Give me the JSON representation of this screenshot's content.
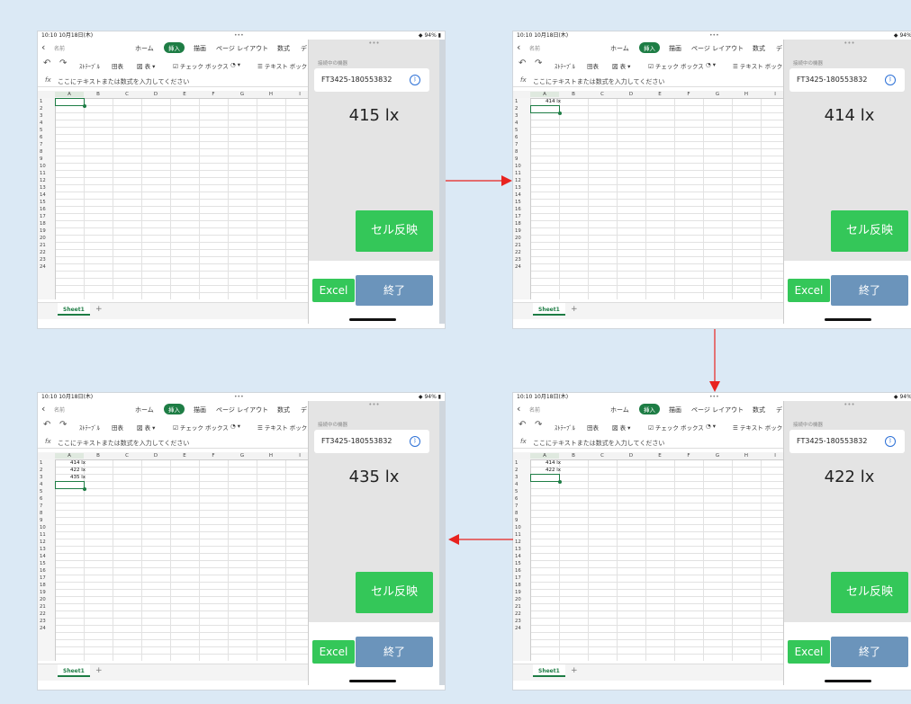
{
  "status": {
    "time": "10:10 10月18日(木)",
    "dots": "•••",
    "battery": "◆ 94% ▮"
  },
  "excel": {
    "file_name": "名前",
    "tabs": [
      "ホーム",
      "挿入",
      "描画",
      "ページ レイアウト",
      "数式",
      "デ"
    ],
    "active_tab": "挿入",
    "toolbar": {
      "undo": "↶",
      "redo": "↷",
      "table_layout": "ｽﾄﾃｰﾌﾞﾙ",
      "table": "田表",
      "chart": "図 表 ▾",
      "checkbox": "☑ チェック ボックス",
      "shapes": "◔ ▾",
      "textbox": "☰ テキスト ボックス"
    },
    "formula_fx": "fx",
    "formula_placeholder": "ここにテキストまたは数式を入力してください",
    "col_headers": [
      "A",
      "B",
      "C",
      "D",
      "E",
      "F",
      "G",
      "H",
      "I"
    ],
    "row_headers": [
      "1",
      "2",
      "3",
      "4",
      "5",
      "6",
      "7",
      "8",
      "9",
      "10",
      "11",
      "12",
      "13",
      "14",
      "15",
      "16",
      "17",
      "18",
      "19",
      "20",
      "21",
      "22",
      "23",
      "24"
    ],
    "sheet_tab": "Sheet1",
    "add_sheet": "+"
  },
  "app": {
    "handle": "•••",
    "label": "接続中の機器",
    "device_id": "FT3425-180553832",
    "bt_icon": "bluetooth-icon",
    "bt_glyph": "ᛒ",
    "reflect_label": "セル反映",
    "excel_label": "Excel",
    "end_label": "終了"
  },
  "panels": [
    {
      "lux": "415 lx",
      "cells": [],
      "selected_row": 1
    },
    {
      "lux": "414 lx",
      "cells": [
        "414 lx"
      ],
      "selected_row": 2
    },
    {
      "lux": "435 lx",
      "cells": [
        "414 lx",
        "422 lx",
        "435 lx"
      ],
      "selected_row": 4
    },
    {
      "lux": "422 lx",
      "cells": [
        "414 lx",
        "422 lx"
      ],
      "selected_row": 3
    }
  ],
  "arrows": [
    "arrow-right",
    "arrow-down",
    "arrow-left"
  ],
  "colors": {
    "arrow": "#e8231f",
    "accent_green": "#1e7d45",
    "button_green": "#34c759",
    "end_button": "#6b94bb",
    "background": "#dbe9f5"
  }
}
